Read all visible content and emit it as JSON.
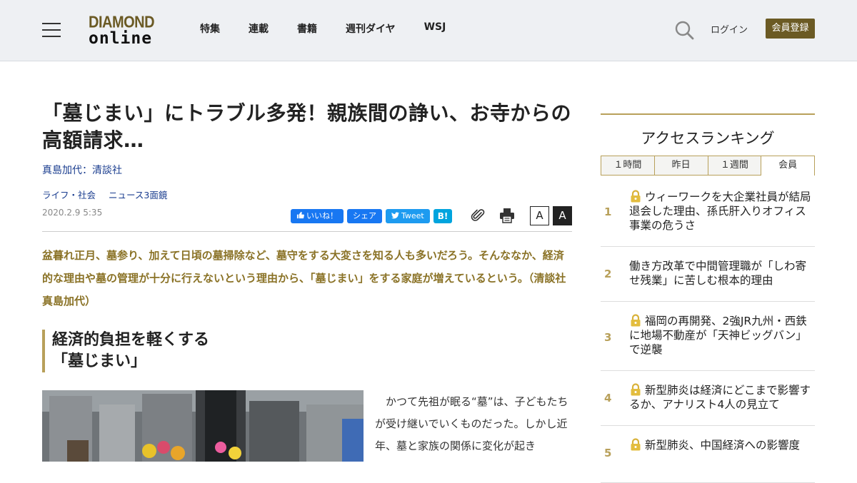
{
  "header": {
    "logo_top": "DIAMOND",
    "logo_bottom": "online",
    "nav": [
      "特集",
      "連載",
      "書籍",
      "週刊ダイヤ",
      "WSJ"
    ],
    "login_label": "ログイン",
    "register_label": "会員登録",
    "accent_color": "#6b5a24"
  },
  "article": {
    "title": "「墓じまい」にトラブル多発！親族間の諍い、お寺からの高額請求…",
    "author": "真島加代：清談社",
    "tags": [
      "ライフ・社会",
      "ニュース3面鏡"
    ],
    "date": "2020.2.9 5:35",
    "share": {
      "like": "いいね！",
      "share": "シェア",
      "tweet": "Tweet",
      "hatena": "B!"
    },
    "font_small": "A",
    "font_large": "A",
    "lead": "盆暮れ正月、墓参り、加えて日頃の墓掃除など、墓守をする大変さを知る人も多いだろう。そんななか、経済的な理由や墓の管理が十分に行えないという理由から、「墓じまい」をする家庭が増えているという。（清談社　真島加代）",
    "subhead_line1": "経済的負担を軽くする",
    "subhead_line2": "「墓じまい」",
    "body": "かつて先祖が眠る“墓”は、子どもたちが受け継いでいくものだった。しかし近年、墓と家族の関係に変化が起き"
  },
  "ranking": {
    "title": "アクセスランキング",
    "tabs": [
      "１時間",
      "昨日",
      "１週間",
      "会員"
    ],
    "active_tab": 3,
    "items": [
      {
        "rank": "1",
        "locked": true,
        "text": "ウィーワークを大企業社員が結局退会した理由、孫氏肝入りオフィス事業の危うさ"
      },
      {
        "rank": "2",
        "locked": false,
        "text": "働き方改革で中間管理職が「しわ寄せ残業」に苦しむ根本的理由"
      },
      {
        "rank": "3",
        "locked": true,
        "text": "福岡の再開発、2強JR九州・西鉄に地場不動産が「天神ビッグバン」で逆襲"
      },
      {
        "rank": "4",
        "locked": true,
        "text": "新型肺炎は経済にどこまで影響するか、アナリスト4人の見立て"
      },
      {
        "rank": "5",
        "locked": true,
        "text": "新型肺炎、中国経済への影響度"
      }
    ]
  }
}
